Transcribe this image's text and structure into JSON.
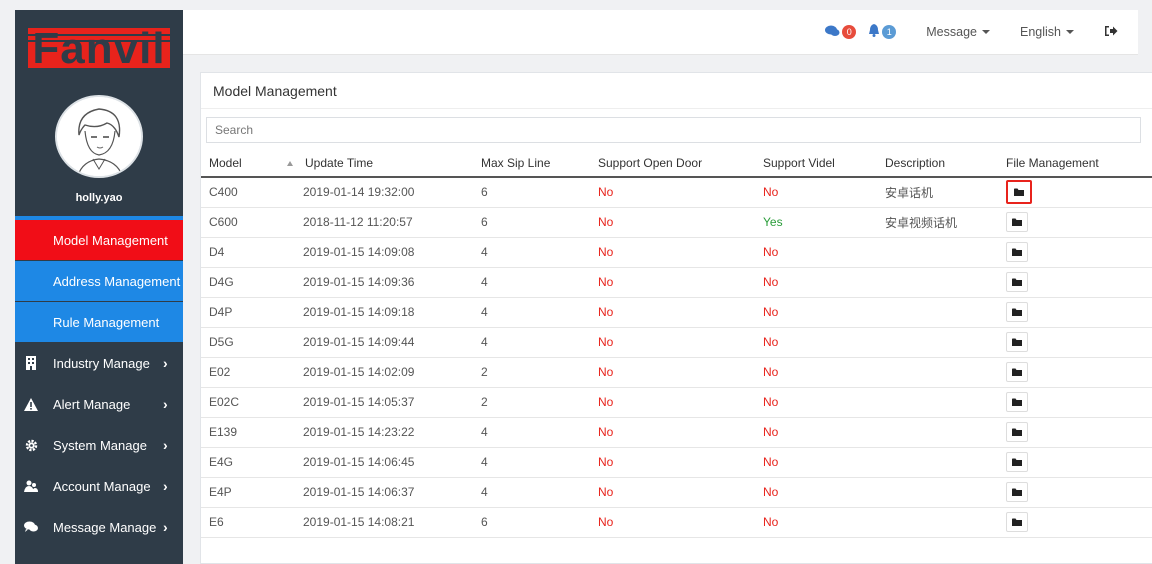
{
  "brand": {
    "logo_text": "Fanvil",
    "logo_color": "#e8231c"
  },
  "user": {
    "name": "holly.yao"
  },
  "sidebar": {
    "active_color": "#f10d17",
    "sub_color": "#1e88e5",
    "items": [
      {
        "label": "Model Management",
        "type": "sub",
        "active": true
      },
      {
        "label": "Address Management",
        "type": "sub"
      },
      {
        "label": "Rule Management",
        "type": "sub"
      },
      {
        "label": "Industry Manage",
        "type": "group",
        "icon": "building-icon"
      },
      {
        "label": "Alert Manage",
        "type": "group",
        "icon": "warning-icon"
      },
      {
        "label": "System Manage",
        "type": "group",
        "icon": "gear-icon"
      },
      {
        "label": "Account Manage",
        "type": "group",
        "icon": "users-icon"
      },
      {
        "label": "Message Manage",
        "type": "group",
        "icon": "chat-icon"
      }
    ]
  },
  "topbar": {
    "chat_count": "0",
    "alert_count": "1",
    "message_label": "Message",
    "language_label": "English"
  },
  "panel": {
    "title": "Model Management",
    "search_placeholder": "Search"
  },
  "table": {
    "columns": [
      "Model",
      "Update Time",
      "Max Sip Line",
      "Support Open Door",
      "Support Videl",
      "Description",
      "File Management"
    ],
    "rows": [
      {
        "model": "C400",
        "update_time": "2019-01-14 19:32:00",
        "max_sip": "6",
        "open_door": "No",
        "video": "No",
        "description": "安卓话机",
        "highlight": true
      },
      {
        "model": "C600",
        "update_time": "2018-11-12 11:20:57",
        "max_sip": "6",
        "open_door": "No",
        "video": "Yes",
        "description": "安卓视频话机"
      },
      {
        "model": "D4",
        "update_time": "2019-01-15 14:09:08",
        "max_sip": "4",
        "open_door": "No",
        "video": "No",
        "description": ""
      },
      {
        "model": "D4G",
        "update_time": "2019-01-15 14:09:36",
        "max_sip": "4",
        "open_door": "No",
        "video": "No",
        "description": ""
      },
      {
        "model": "D4P",
        "update_time": "2019-01-15 14:09:18",
        "max_sip": "4",
        "open_door": "No",
        "video": "No",
        "description": ""
      },
      {
        "model": "D5G",
        "update_time": "2019-01-15 14:09:44",
        "max_sip": "4",
        "open_door": "No",
        "video": "No",
        "description": ""
      },
      {
        "model": "E02",
        "update_time": "2019-01-15 14:02:09",
        "max_sip": "2",
        "open_door": "No",
        "video": "No",
        "description": ""
      },
      {
        "model": "E02C",
        "update_time": "2019-01-15 14:05:37",
        "max_sip": "2",
        "open_door": "No",
        "video": "No",
        "description": ""
      },
      {
        "model": "E139",
        "update_time": "2019-01-15 14:23:22",
        "max_sip": "4",
        "open_door": "No",
        "video": "No",
        "description": ""
      },
      {
        "model": "E4G",
        "update_time": "2019-01-15 14:06:45",
        "max_sip": "4",
        "open_door": "No",
        "video": "No",
        "description": ""
      },
      {
        "model": "E4P",
        "update_time": "2019-01-15 14:06:37",
        "max_sip": "4",
        "open_door": "No",
        "video": "No",
        "description": ""
      },
      {
        "model": "E6",
        "update_time": "2019-01-15 14:08:21",
        "max_sip": "6",
        "open_door": "No",
        "video": "No",
        "description": ""
      }
    ]
  }
}
